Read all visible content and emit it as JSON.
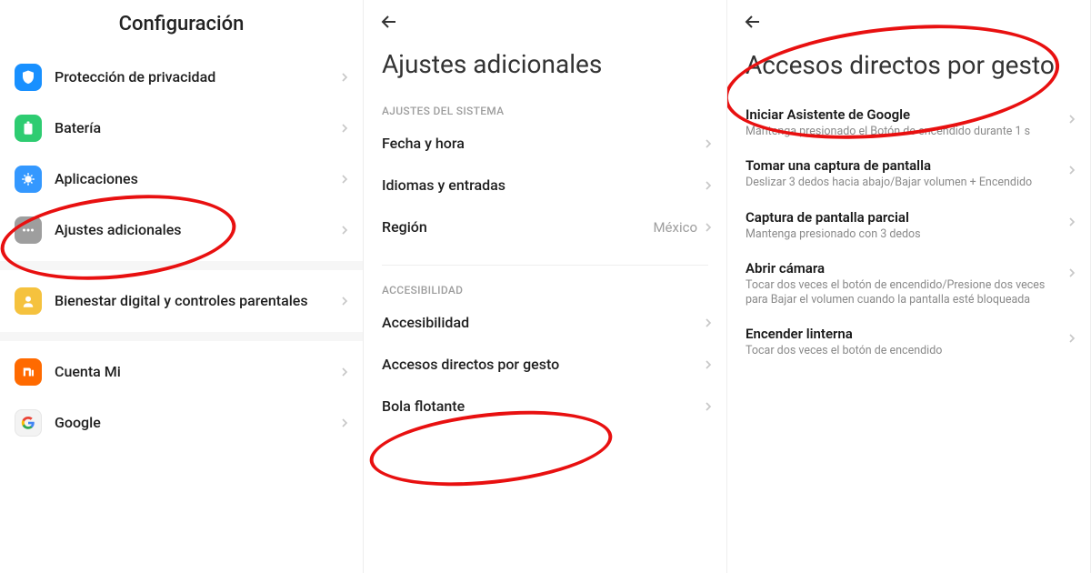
{
  "panel1": {
    "title": "Configuración",
    "items": [
      {
        "label": "Protección de privacidad"
      },
      {
        "label": "Batería"
      },
      {
        "label": "Aplicaciones"
      },
      {
        "label": "Ajustes adicionales"
      }
    ],
    "group2": [
      {
        "label": "Bienestar digital y controles parentales"
      }
    ],
    "group3": [
      {
        "label": "Cuenta Mi"
      },
      {
        "label": "Google"
      }
    ]
  },
  "panel2": {
    "title": "Ajustes adicionales",
    "section1_header": "Ajustes del sistema",
    "section1": [
      {
        "label": "Fecha y hora",
        "value": ""
      },
      {
        "label": "Idiomas y entradas",
        "value": ""
      },
      {
        "label": "Región",
        "value": "México"
      }
    ],
    "section2_header": "Accesibilidad",
    "section2": [
      {
        "label": "Accesibilidad"
      },
      {
        "label": "Accesos directos por gesto"
      },
      {
        "label": "Bola flotante"
      }
    ]
  },
  "panel3": {
    "title": "Accesos directos por gesto",
    "items": [
      {
        "title": "Iniciar Asistente de Google",
        "sub": "Mantenga presionado el Botón de encendido durante 1 s"
      },
      {
        "title": "Tomar una captura de pantalla",
        "sub": "Deslizar 3 dedos hacia abajo/Bajar volumen + Encendido"
      },
      {
        "title": "Captura de pantalla parcial",
        "sub": "Mantenga presionado con 3 dedos"
      },
      {
        "title": "Abrir cámara",
        "sub": "Tocar dos veces el botón de encendido/Presione dos veces para Bajar el volumen cuando la pantalla esté bloqueada"
      },
      {
        "title": "Encender linterna",
        "sub": "Tocar dos veces el botón de encendido"
      }
    ]
  }
}
